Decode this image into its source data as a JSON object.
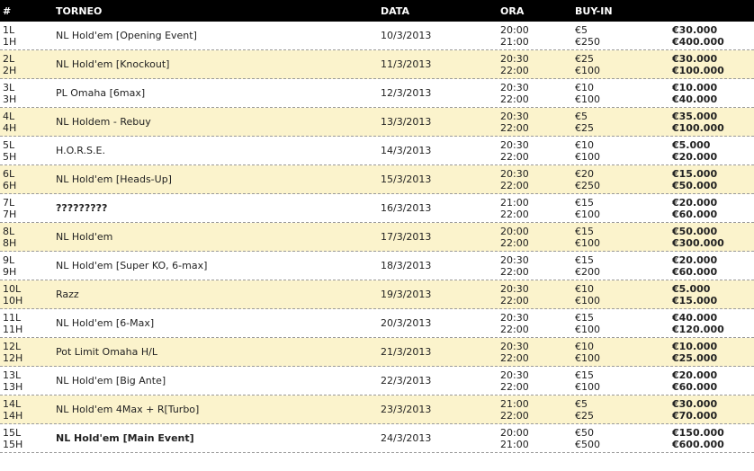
{
  "header": {
    "num": "#",
    "torneo": "TORNEO",
    "data": "DATA",
    "ora": "ORA",
    "buyin": "BUY-IN"
  },
  "rows": [
    {
      "l": "1L",
      "h": "1H",
      "name": "NL Hold'em [Opening Event]",
      "date": "10/3/2013",
      "t1": "20:00",
      "t2": "21:00",
      "b1": "€5",
      "b2": "€250",
      "p1": "€30.000",
      "p2": "€400.000"
    },
    {
      "l": "2L",
      "h": "2H",
      "name": "NL Hold'em [Knockout]",
      "date": "11/3/2013",
      "t1": "20:30",
      "t2": "22:00",
      "b1": "€25",
      "b2": "€100",
      "p1": "€30.000",
      "p2": "€100.000"
    },
    {
      "l": "3L",
      "h": "3H",
      "name": "PL Omaha [6max]",
      "date": "12/3/2013",
      "t1": "20:30",
      "t2": "22:00",
      "b1": "€10",
      "b2": "€100",
      "p1": "€10.000",
      "p2": "€40.000"
    },
    {
      "l": "4L",
      "h": "4H",
      "name": "NL Holdem - Rebuy",
      "date": "13/3/2013",
      "t1": "20:30",
      "t2": "22:00",
      "b1": "€5",
      "b2": "€25",
      "p1": "€35.000",
      "p2": "€100.000"
    },
    {
      "l": "5L",
      "h": "5H",
      "name": "H.O.R.S.E.",
      "date": "14/3/2013",
      "t1": "20:30",
      "t2": "22:00",
      "b1": "€10",
      "b2": "€100",
      "p1": "€5.000",
      "p2": "€20.000"
    },
    {
      "l": "6L",
      "h": "6H",
      "name": "NL Hold'em [Heads-Up]",
      "date": "15/3/2013",
      "t1": "20:30",
      "t2": "22:00",
      "b1": "€20",
      "b2": "€250",
      "p1": "€15.000",
      "p2": "€50.000"
    },
    {
      "l": "7L",
      "h": "7H",
      "name": "?????????",
      "date": "16/3/2013",
      "t1": "21:00",
      "t2": "22:00",
      "b1": "€15",
      "b2": "€100",
      "p1": "€20.000",
      "p2": "€60.000",
      "bold": true
    },
    {
      "l": "8L",
      "h": "8H",
      "name": "NL Hold'em",
      "date": "17/3/2013",
      "t1": "20:00",
      "t2": "22:00",
      "b1": "€15",
      "b2": "€100",
      "p1": "€50.000",
      "p2": "€300.000"
    },
    {
      "l": "9L",
      "h": "9H",
      "name": "NL Hold'em [Super KO, 6-max]",
      "date": "18/3/2013",
      "t1": "20:30",
      "t2": "22:00",
      "b1": "€15",
      "b2": "€200",
      "p1": "€20.000",
      "p2": "€60.000"
    },
    {
      "l": "10L",
      "h": "10H",
      "name": "Razz",
      "date": "19/3/2013",
      "t1": "20:30",
      "t2": "22:00",
      "b1": "€10",
      "b2": "€100",
      "p1": "€5.000",
      "p2": "€15.000"
    },
    {
      "l": "11L",
      "h": "11H",
      "name": "NL Hold'em [6-Max]",
      "date": "20/3/2013",
      "t1": "20:30",
      "t2": "22:00",
      "b1": "€15",
      "b2": "€100",
      "p1": "€40.000",
      "p2": "€120.000"
    },
    {
      "l": "12L",
      "h": "12H",
      "name": "Pot Limit Omaha H/L",
      "date": "21/3/2013",
      "t1": "20:30",
      "t2": "22:00",
      "b1": "€10",
      "b2": "€100",
      "p1": "€10.000",
      "p2": "€25.000"
    },
    {
      "l": "13L",
      "h": "13H",
      "name": "NL Hold'em [Big Ante]",
      "date": "22/3/2013",
      "t1": "20:30",
      "t2": "22:00",
      "b1": "€15",
      "b2": "€100",
      "p1": "€20.000",
      "p2": "€60.000"
    },
    {
      "l": "14L",
      "h": "14H",
      "name": "NL Hold'em 4Max + R[Turbo]",
      "date": "23/3/2013",
      "t1": "21:00",
      "t2": "22:00",
      "b1": "€5",
      "b2": "€25",
      "p1": "€30.000",
      "p2": "€70.000"
    },
    {
      "l": "15L",
      "h": "15H",
      "name": "NL Hold'em [Main Event]",
      "date": "24/3/2013",
      "t1": "20:00",
      "t2": "21:00",
      "b1": "€50",
      "b2": "€500",
      "p1": "€150.000",
      "p2": "€600.000",
      "bold": true
    }
  ]
}
